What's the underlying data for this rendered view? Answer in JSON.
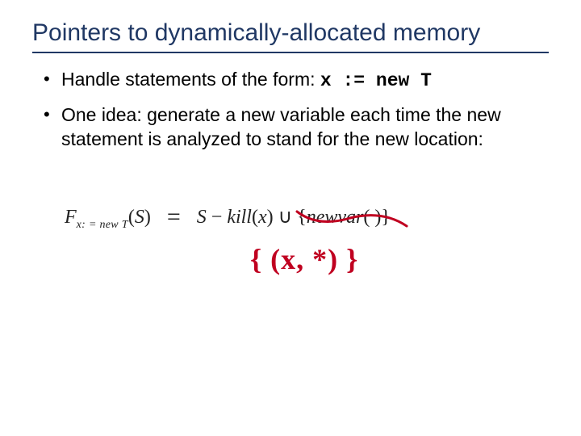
{
  "title": "Pointers to dynamically-allocated memory",
  "bullets": [
    {
      "pre": "Handle statements of the form: ",
      "code": "x := new T",
      "post": ""
    },
    {
      "pre": "One idea: generate a new variable each time the new statement is analyzed to stand for the new location:",
      "code": "",
      "post": ""
    }
  ],
  "formula": {
    "F": "F",
    "sub": "x: = new  T",
    "argL": "(",
    "arg": "S",
    "argR": ")",
    "eq": "=",
    "rhs_S": "S",
    "rhs_minus": " − ",
    "rhs_kill": "kill",
    "rhs_killArgL": "(",
    "rhs_killArg": "x",
    "rhs_killArgR": ")",
    "rhs_cup": " ∪ ",
    "rhs_setL": "{",
    "rhs_newvar": "newvar",
    "rhs_newvarPar": "( )",
    "rhs_setR": "}"
  },
  "hand": "{ (x, *) }",
  "colors": {
    "title": "#203864",
    "hand": "#c00020"
  }
}
